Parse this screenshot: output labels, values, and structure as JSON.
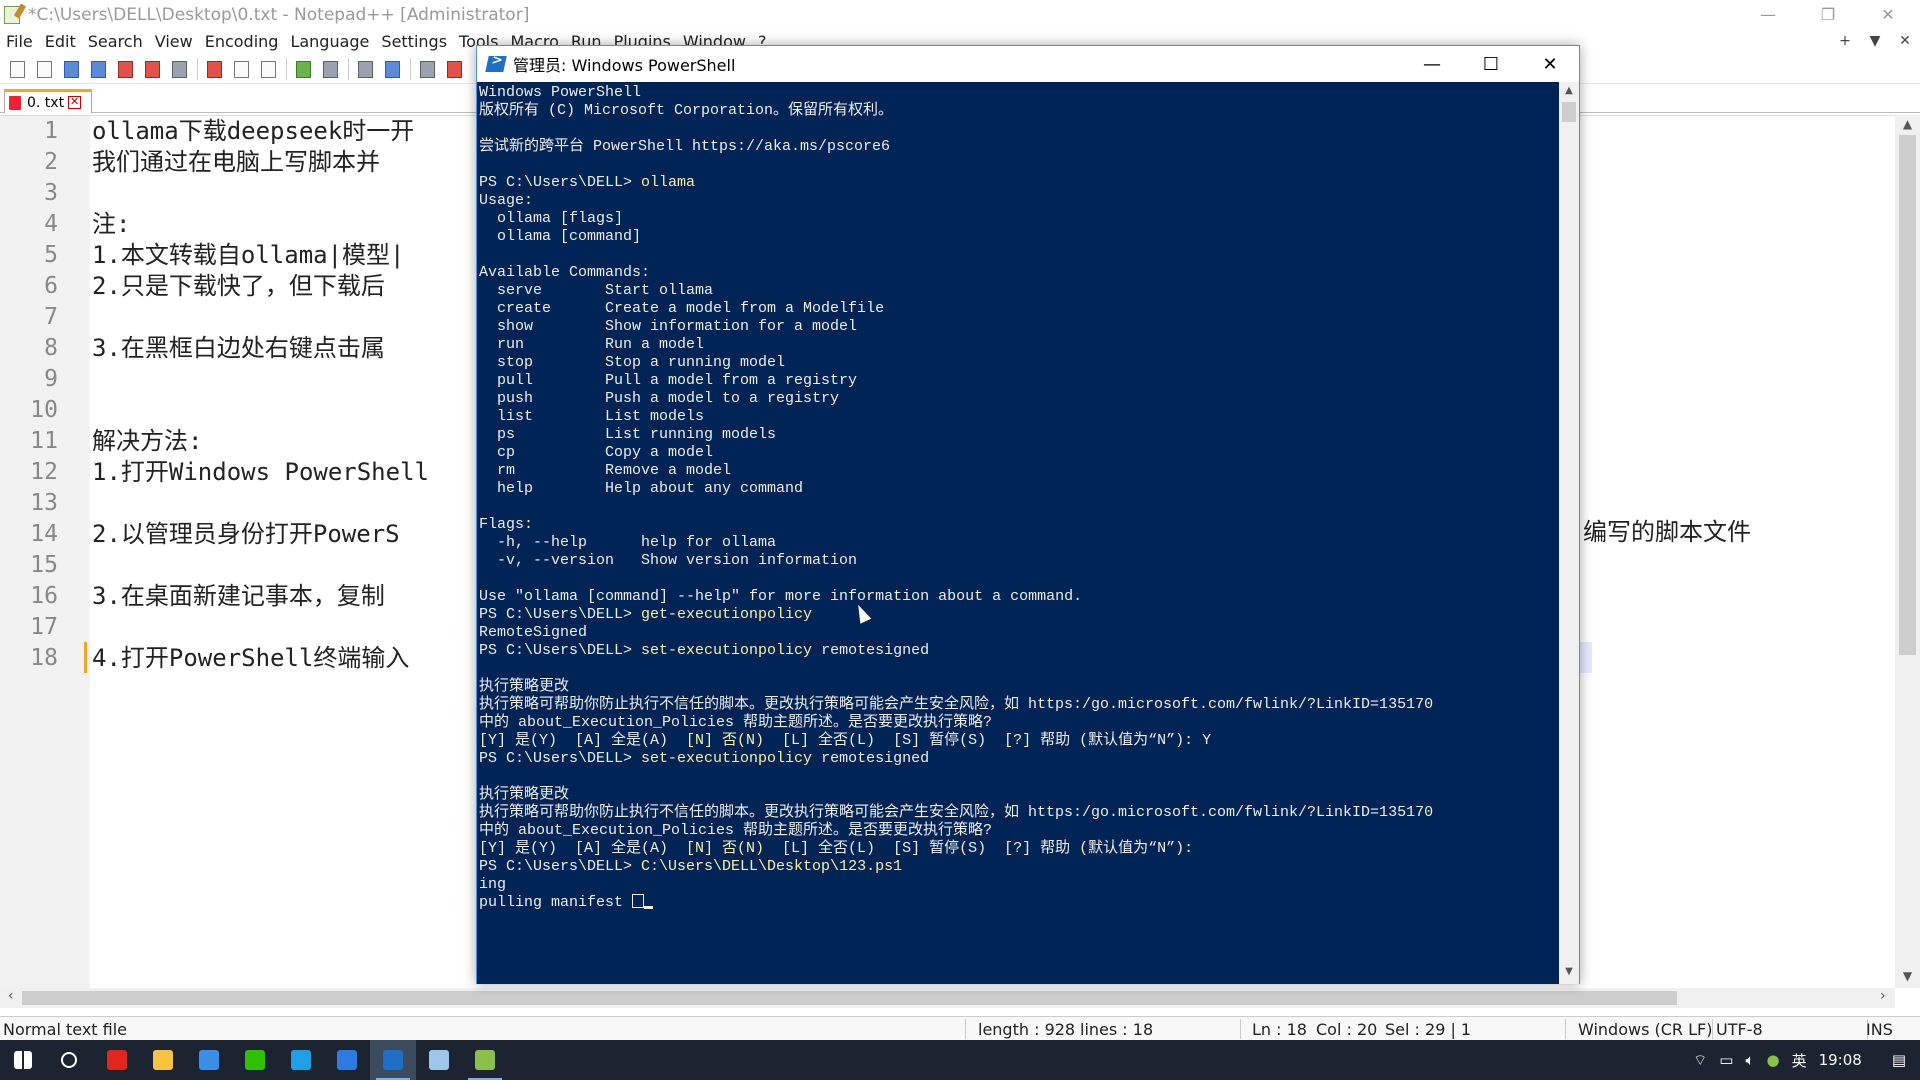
{
  "npp": {
    "title": "*C:\\Users\\DELL\\Desktop\\0.txt - Notepad++ [Administrator]",
    "menu": [
      "File",
      "Edit",
      "Search",
      "View",
      "Encoding",
      "Language",
      "Settings",
      "Tools",
      "Macro",
      "Run",
      "Plugins",
      "Window",
      "?"
    ],
    "menu_right": [
      "+",
      "▼",
      "✕"
    ],
    "tab_label": "0. txt",
    "lines": [
      {
        "n": "1",
        "text": "ollama下载deepseek时一开"
      },
      {
        "n": "2",
        "text": "我们通过在电脑上写脚本并"
      },
      {
        "n": "3",
        "text": ""
      },
      {
        "n": "4",
        "text": "注:"
      },
      {
        "n": "5",
        "text": "1.本文转载自ollama|模型|"
      },
      {
        "n": "6",
        "text": "2.只是下载快了，但下载后"
      },
      {
        "n": "7",
        "text": ""
      },
      {
        "n": "8",
        "text": "3.在黑框白边处右键点击属"
      },
      {
        "n": "9",
        "text": ""
      },
      {
        "n": "10",
        "text": ""
      },
      {
        "n": "11",
        "text": "解决方法:"
      },
      {
        "n": "12",
        "text": "1.打开Windows PowerShell"
      },
      {
        "n": "13",
        "text": ""
      },
      {
        "n": "14",
        "text": "2.以管理员身份打开PowerS"
      },
      {
        "n": "15",
        "text": ""
      },
      {
        "n": "16",
        "text": "3.在桌面新建记事本，复制"
      },
      {
        "n": "17",
        "text": ""
      },
      {
        "n": "18",
        "text": "4.打开PowerShell终端输入"
      }
    ],
    "line14_tail": "编写的脚本文件",
    "status": {
      "type": "Normal text file",
      "length": "length : 928",
      "lines": "lines : 18",
      "ln": "Ln : 18",
      "col": "Col : 20",
      "sel": "Sel : 29 | 1",
      "eol": "Windows (CR LF)",
      "enc": "UTF-8",
      "mode": "INS"
    }
  },
  "ps": {
    "title": "管理员: Windows PowerShell",
    "lines": [
      {
        "t": "Windows PowerShell"
      },
      {
        "t": "版权所有 (C) Microsoft Corporation。保留所有权利。"
      },
      {
        "t": ""
      },
      {
        "t": "尝试新的跨平台 PowerShell https://aka.ms/pscore6"
      },
      {
        "t": ""
      },
      {
        "p": "PS C:\\Users\\DELL> ",
        "c": "ollama"
      },
      {
        "t": "Usage:"
      },
      {
        "t": "  ollama [flags]"
      },
      {
        "t": "  ollama [command]"
      },
      {
        "t": ""
      },
      {
        "t": "Available Commands:"
      },
      {
        "t": "  serve       Start ollama"
      },
      {
        "t": "  create      Create a model from a Modelfile"
      },
      {
        "t": "  show        Show information for a model"
      },
      {
        "t": "  run         Run a model"
      },
      {
        "t": "  stop        Stop a running model"
      },
      {
        "t": "  pull        Pull a model from a registry"
      },
      {
        "t": "  push        Push a model to a registry"
      },
      {
        "t": "  list        List models"
      },
      {
        "t": "  ps          List running models"
      },
      {
        "t": "  cp          Copy a model"
      },
      {
        "t": "  rm          Remove a model"
      },
      {
        "t": "  help        Help about any command"
      },
      {
        "t": ""
      },
      {
        "t": "Flags:"
      },
      {
        "t": "  -h, --help      help for ollama"
      },
      {
        "t": "  -v, --version   Show version information"
      },
      {
        "t": ""
      },
      {
        "t": "Use \"ollama [command] --help\" for more information about a command."
      },
      {
        "p": "PS C:\\Users\\DELL> ",
        "c": "get-executionpolicy"
      },
      {
        "t": "RemoteSigned"
      },
      {
        "p": "PS C:\\Users\\DELL> ",
        "c": "set-executionpolicy",
        "r": " remotesigned"
      },
      {
        "t": ""
      },
      {
        "t": "执行策略更改"
      },
      {
        "t": "执行策略可帮助你防止执行不信任的脚本。更改执行策略可能会产生安全风险，如 https:/go.microsoft.com/fwlink/?LinkID=135170"
      },
      {
        "t": "中的 about_Execution_Policies 帮助主题所述。是否要更改执行策略?"
      },
      {
        "t": "[Y] 是(Y)  [A] 全是(A)  ",
        "c": "[N] 否(N)",
        "r": "  [L] 全否(L)  [S] 暂停(S)  [?] 帮助 (默认值为“N”): Y"
      },
      {
        "p": "PS C:\\Users\\DELL> ",
        "c": "set-executionpolicy",
        "r": " remotesigned"
      },
      {
        "t": ""
      },
      {
        "t": "执行策略更改"
      },
      {
        "t": "执行策略可帮助你防止执行不信任的脚本。更改执行策略可能会产生安全风险，如 https:/go.microsoft.com/fwlink/?LinkID=135170"
      },
      {
        "t": "中的 about_Execution_Policies 帮助主题所述。是否要更改执行策略?"
      },
      {
        "t": "[Y] 是(Y)  [A] 全是(A)  ",
        "c": "[N] 否(N)",
        "r": "  [L] 全否(L)  [S] 暂停(S)  [?] 帮助 (默认值为“N”):"
      },
      {
        "p": "PS C:\\Users\\DELL> ",
        "c": "C:\\Users\\DELL\\Desktop\\123.ps1"
      },
      {
        "t": "ing"
      },
      {
        "t": "pulling manifest ",
        "cursor": true
      }
    ]
  },
  "taskbar": {
    "clock": "19:08",
    "ime": "英",
    "apps": [
      {
        "name": "start",
        "color": "#ffffff"
      },
      {
        "name": "search",
        "color": "#ffffff"
      },
      {
        "name": "acrobat",
        "color": "#e1261c"
      },
      {
        "name": "file-explorer",
        "color": "#f6c343"
      },
      {
        "name": "remote-desktop",
        "color": "#3a8ee6"
      },
      {
        "name": "wechat",
        "color": "#2dc100"
      },
      {
        "name": "edge",
        "color": "#1fa0e6"
      },
      {
        "name": "photos",
        "color": "#2d7be0"
      },
      {
        "name": "powershell",
        "color": "#1f6fc4"
      },
      {
        "name": "notepad",
        "color": "#9ec6e8"
      },
      {
        "name": "notepad-plus-plus",
        "color": "#8ac04a"
      }
    ]
  }
}
